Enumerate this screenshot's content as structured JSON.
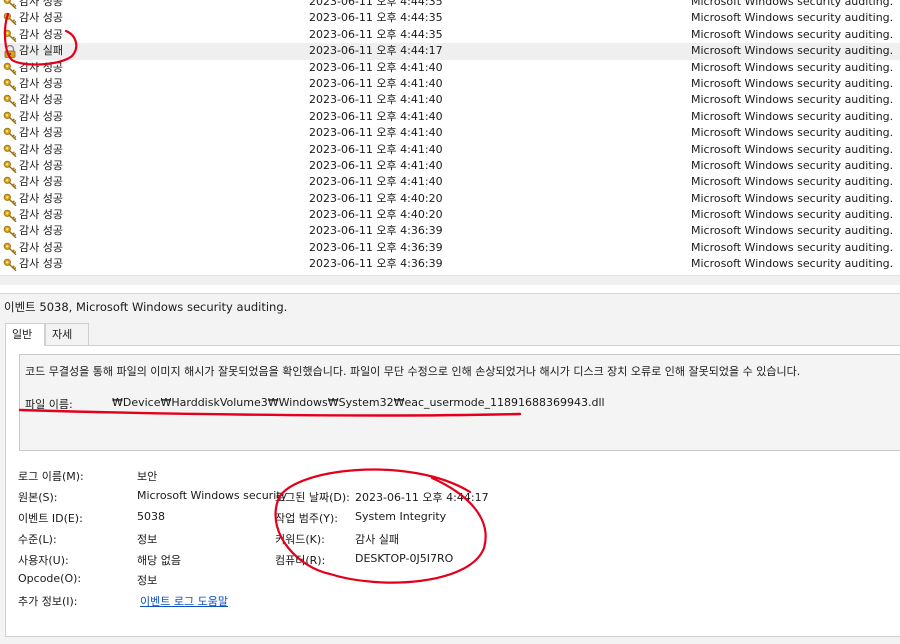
{
  "events": [
    {
      "level": "감사 성공",
      "date": "2023-06-11 오후 4:44:35",
      "source": "Microsoft Windows security auditing.",
      "icon": "key-icon"
    },
    {
      "level": "감사 성공",
      "date": "2023-06-11 오후 4:44:35",
      "source": "Microsoft Windows security auditing.",
      "icon": "key-icon"
    },
    {
      "level": "감사 성공",
      "date": "2023-06-11 오후 4:44:35",
      "source": "Microsoft Windows security auditing.",
      "icon": "key-icon"
    },
    {
      "level": "감사 실패",
      "date": "2023-06-11 오후 4:44:17",
      "source": "Microsoft Windows security auditing.",
      "icon": "lock-icon",
      "selected": true
    },
    {
      "level": "감사 성공",
      "date": "2023-06-11 오후 4:41:40",
      "source": "Microsoft Windows security auditing.",
      "icon": "key-icon"
    },
    {
      "level": "감사 성공",
      "date": "2023-06-11 오후 4:41:40",
      "source": "Microsoft Windows security auditing.",
      "icon": "key-icon"
    },
    {
      "level": "감사 성공",
      "date": "2023-06-11 오후 4:41:40",
      "source": "Microsoft Windows security auditing.",
      "icon": "key-icon"
    },
    {
      "level": "감사 성공",
      "date": "2023-06-11 오후 4:41:40",
      "source": "Microsoft Windows security auditing.",
      "icon": "key-icon"
    },
    {
      "level": "감사 성공",
      "date": "2023-06-11 오후 4:41:40",
      "source": "Microsoft Windows security auditing.",
      "icon": "key-icon"
    },
    {
      "level": "감사 성공",
      "date": "2023-06-11 오후 4:41:40",
      "source": "Microsoft Windows security auditing.",
      "icon": "key-icon"
    },
    {
      "level": "감사 성공",
      "date": "2023-06-11 오후 4:41:40",
      "source": "Microsoft Windows security auditing.",
      "icon": "key-icon"
    },
    {
      "level": "감사 성공",
      "date": "2023-06-11 오후 4:41:40",
      "source": "Microsoft Windows security auditing.",
      "icon": "key-icon"
    },
    {
      "level": "감사 성공",
      "date": "2023-06-11 오후 4:40:20",
      "source": "Microsoft Windows security auditing.",
      "icon": "key-icon"
    },
    {
      "level": "감사 성공",
      "date": "2023-06-11 오후 4:40:20",
      "source": "Microsoft Windows security auditing.",
      "icon": "key-icon"
    },
    {
      "level": "감사 성공",
      "date": "2023-06-11 오후 4:36:39",
      "source": "Microsoft Windows security auditing.",
      "icon": "key-icon"
    },
    {
      "level": "감사 성공",
      "date": "2023-06-11 오후 4:36:39",
      "source": "Microsoft Windows security auditing.",
      "icon": "key-icon"
    },
    {
      "level": "감사 성공",
      "date": "2023-06-11 오후 4:36:39",
      "source": "Microsoft Windows security auditing.",
      "icon": "key-icon"
    }
  ],
  "detail": {
    "title": "이벤트 5038, Microsoft Windows security auditing.",
    "tabs": [
      "일반",
      "자세히"
    ],
    "active_tab": "일반",
    "description": "코드 무결성을 통해 파일의 이미지 해시가 잘못되었음을 확인했습니다. 파일이 무단 수정으로 인해 손상되었거나 해시가 디스크 장치 오류로 인해 잘못되었을 수 있습니다.",
    "file_label": "파일 이름:",
    "file_path": "₩Device₩HarddiskVolume3₩Windows₩System32₩eac_usermode_11891688369943.dll",
    "props": {
      "log_name": {
        "label": "로그 이름(M):",
        "value": "보안"
      },
      "source": {
        "label": "원본(S):",
        "value": "Microsoft Windows security"
      },
      "event_id": {
        "label": "이벤트 ID(E):",
        "value": "5038"
      },
      "level": {
        "label": "수준(L):",
        "value": "정보"
      },
      "user": {
        "label": "사용자(U):",
        "value": "해당 없음"
      },
      "opcode": {
        "label": "Opcode(O):",
        "value": "정보"
      },
      "more_info": {
        "label": "추가 정보(I):",
        "value": "이벤트 로그 도움말"
      },
      "logged": {
        "label": "로그된 날짜(D):",
        "value": "2023-06-11 오후 4:44:17"
      },
      "task_category": {
        "label": "작업 범주(Y):",
        "value": "System Integrity"
      },
      "keywords": {
        "label": "키워드(K):",
        "value": "감사 실패"
      },
      "computer": {
        "label": "컴퓨터(R):",
        "value": "DESKTOP-0J5I7RO"
      }
    }
  },
  "colors": {
    "annotation": "#e3001b",
    "link": "#0b52c6",
    "selected_row": "#efefef",
    "pane_bg": "#f3f3f3"
  }
}
